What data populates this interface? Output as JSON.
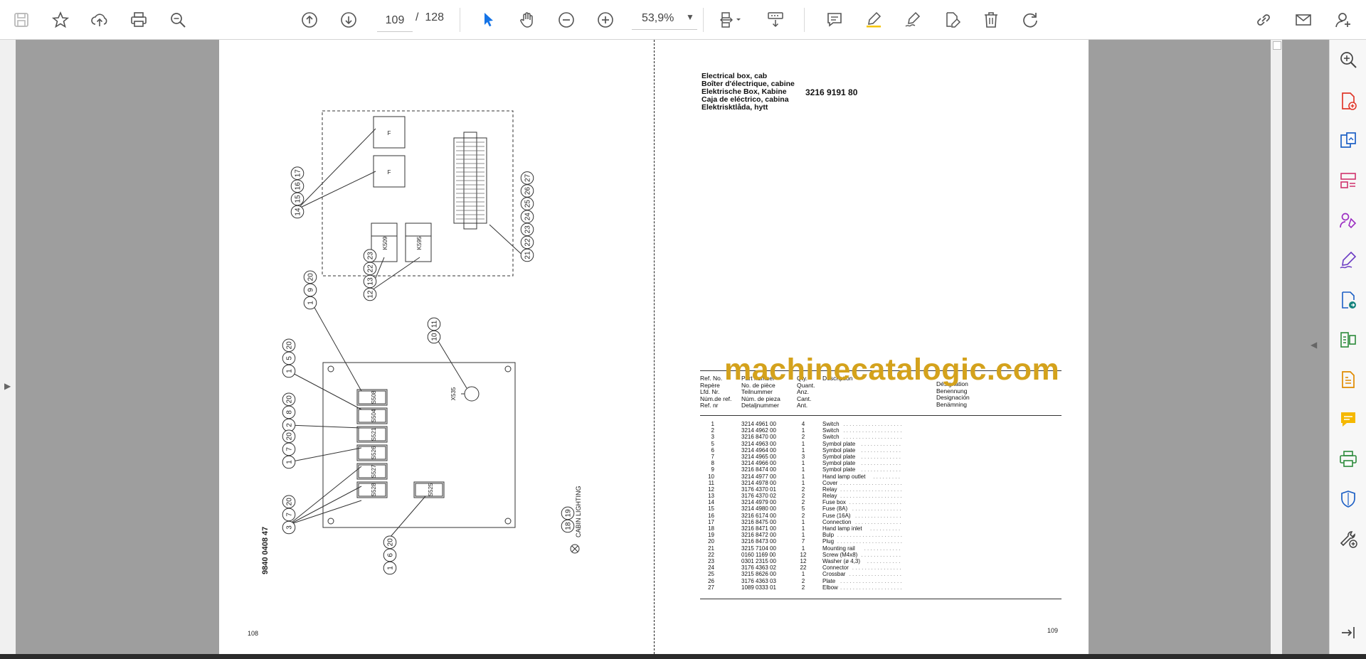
{
  "toolbar": {
    "page_current": "109",
    "page_total": "128",
    "page_separator": "/",
    "zoom": "53,9%",
    "icons": [
      "save-icon",
      "bookmark-star-icon",
      "upload-cloud-icon",
      "print-icon",
      "find-zoom-icon",
      "page-up-icon",
      "page-down-icon",
      "select-cursor-icon",
      "hand-pan-icon",
      "zoom-out-icon",
      "zoom-in-icon",
      "zoom-caret-icon",
      "fit-page-icon",
      "scroll-mode-icon",
      "comment-icon",
      "highlight-pen-icon",
      "sign-icon",
      "edit-text-icon",
      "delete-icon",
      "rotate-icon",
      "share-link-icon",
      "email-icon",
      "account-icon"
    ]
  },
  "right_sidebar": {
    "icons": [
      "zoom-search-icon",
      "create-pdf-icon",
      "export-pdf-icon",
      "organize-pages-icon",
      "request-signature-icon",
      "fill-sign-icon",
      "send-to-icon",
      "compress-icon",
      "edit-pdf-icon",
      "comment-tool-icon",
      "print-production-icon",
      "protect-icon",
      "more-tools-icon",
      "collapse-panel-icon"
    ]
  },
  "document": {
    "left_page_number": "108",
    "right_page_number": "109",
    "drawing_number": "9840 0408 47",
    "cabin_lighting_label": "CABIN LIGHTING",
    "header_lines": [
      "Electrical box, cab",
      "Boîter d'électrique, cabine",
      "Elektrische Box, Kabine",
      "Caja de eléctrico, cabina",
      "Elektrisktlåda, hytt"
    ],
    "header_part_number": "3216 9191 80",
    "watermark": "machinecatalogic.com",
    "table_headers": {
      "ref": "Ref. No.\nRepère\nLfd. Nr.\nNúm.de ref.\nRef. nr",
      "part": "Part number\nNo. de pièce\nTeilnummer\nNúm. de pieza\nDetaljnummer",
      "qty": "Qty.\nQuant.\nAnz.\nCant.\nAnt.",
      "desc": "Description",
      "desig": "Désignation\nBenennung\nDesignación\nBenämning"
    },
    "parts": [
      {
        "ref": "1",
        "part": "3214 4961 00",
        "qty": "4",
        "desc": "Switch"
      },
      {
        "ref": "2",
        "part": "3214 4962 00",
        "qty": "1",
        "desc": "Switch"
      },
      {
        "ref": "3",
        "part": "3216 8470 00",
        "qty": "2",
        "desc": "Switch"
      },
      {
        "ref": "5",
        "part": "3214 4963 00",
        "qty": "1",
        "desc": "Symbol plate"
      },
      {
        "ref": "6",
        "part": "3214 4964 00",
        "qty": "1",
        "desc": "Symbol plate"
      },
      {
        "ref": "7",
        "part": "3214 4965 00",
        "qty": "3",
        "desc": "Symbol plate"
      },
      {
        "ref": "8",
        "part": "3214 4966 00",
        "qty": "1",
        "desc": "Symbol plate"
      },
      {
        "ref": "9",
        "part": "3216 8474 00",
        "qty": "1",
        "desc": "Symbol plate"
      },
      {
        "ref": "10",
        "part": "3214 4977 00",
        "qty": "1",
        "desc": "Hand lamp outlet"
      },
      {
        "ref": "11",
        "part": "3214 4978 00",
        "qty": "1",
        "desc": "Cover"
      },
      {
        "ref": "12",
        "part": "3176 4370 01",
        "qty": "2",
        "desc": "Relay"
      },
      {
        "ref": "13",
        "part": "3176 4370 02",
        "qty": "2",
        "desc": "Relay"
      },
      {
        "ref": "14",
        "part": "3214 4979 00",
        "qty": "2",
        "desc": "Fuse box"
      },
      {
        "ref": "15",
        "part": "3214 4980 00",
        "qty": "5",
        "desc": "Fuse (8A)"
      },
      {
        "ref": "16",
        "part": "3216 6174 00",
        "qty": "2",
        "desc": "Fuse (16A)"
      },
      {
        "ref": "17",
        "part": "3216 8475 00",
        "qty": "1",
        "desc": "Connection"
      },
      {
        "ref": "18",
        "part": "3216 8471 00",
        "qty": "1",
        "desc": "Hand lamp inlet"
      },
      {
        "ref": "19",
        "part": "3216 8472 00",
        "qty": "1",
        "desc": "Bulp"
      },
      {
        "ref": "20",
        "part": "3216 8473 00",
        "qty": "7",
        "desc": "Plug"
      },
      {
        "ref": "21",
        "part": "3215 7104 00",
        "qty": "1",
        "desc": "Mounting rail"
      },
      {
        "ref": "22",
        "part": "0160 1169 00",
        "qty": "12",
        "desc": "Screw (M4x8)"
      },
      {
        "ref": "23",
        "part": "0301 2315 00",
        "qty": "12",
        "desc": "Washer (ø 4,3)"
      },
      {
        "ref": "24",
        "part": "3176 4363 02",
        "qty": "22",
        "desc": "Connector"
      },
      {
        "ref": "25",
        "part": "3215 8626 00",
        "qty": "1",
        "desc": "Crossbar"
      },
      {
        "ref": "26",
        "part": "3176 4363 03",
        "qty": "2",
        "desc": "Plate"
      },
      {
        "ref": "27",
        "part": "1089 0333 01",
        "qty": "2",
        "desc": "Elbow"
      }
    ],
    "diagram_labels": {
      "callout_groups": [
        [
          "14",
          "15",
          "16",
          "17"
        ],
        [
          "21",
          "22",
          "23",
          "24",
          "25",
          "26",
          "27"
        ],
        [
          "12",
          "13",
          "22",
          "23"
        ],
        [
          "1",
          "9",
          "20"
        ],
        [
          "10",
          "11"
        ],
        [
          "1",
          "5",
          "20"
        ],
        [
          "2",
          "8",
          "20"
        ],
        [
          "1",
          "7",
          "20"
        ],
        [
          "3",
          "7",
          "20"
        ],
        [
          "1",
          "6",
          "20"
        ],
        [
          "18",
          "19"
        ]
      ],
      "fuse_marks": [
        "F",
        "F"
      ],
      "relay_marks": [
        "K509",
        "K595"
      ],
      "switch_marks": [
        "S508",
        "S504",
        "S521",
        "S526",
        "S527",
        "S528",
        "S525"
      ],
      "lamp_outlet_mark": "X535"
    }
  }
}
